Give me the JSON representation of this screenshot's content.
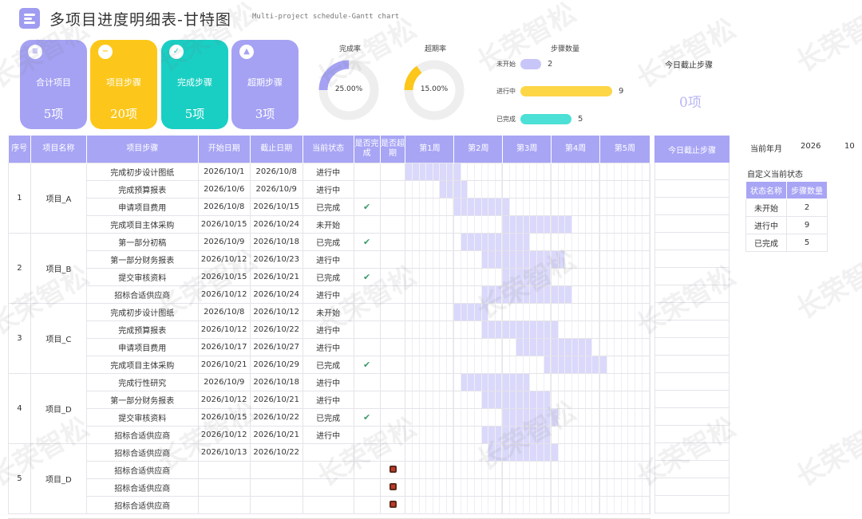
{
  "header": {
    "title": "多项目进度明细表-甘特图",
    "subtitle": "Multi-project schedule-Gantt chart"
  },
  "kpis": [
    {
      "label": "合计项目",
      "value": "5项",
      "color": "#a5a2f4",
      "icon": "list-icon"
    },
    {
      "label": "项目步骤",
      "value": "20项",
      "color": "#fcc71a",
      "icon": "minus-circle-icon"
    },
    {
      "label": "完成步骤",
      "value": "5项",
      "color": "#19cfc3",
      "icon": "check-circle-icon"
    },
    {
      "label": "超期步骤",
      "value": "3项",
      "color": "#a5a2f4",
      "icon": "warning-icon"
    }
  ],
  "donuts": [
    {
      "title": "完成率",
      "value_text": "25.00%",
      "fraction": 0.25,
      "color": "#a5a2f4"
    },
    {
      "title": "超期率",
      "value_text": "15.00%",
      "fraction": 0.15,
      "color": "#fcc71a"
    }
  ],
  "steps": {
    "title": "步骤数量",
    "max": 9,
    "rows": [
      {
        "label": "未开始",
        "count": "2",
        "value": 2,
        "color": "#c8c5f8"
      },
      {
        "label": "进行中",
        "count": "9",
        "value": 9,
        "color": "#fdd646"
      },
      {
        "label": "已完成",
        "count": "5",
        "value": 5,
        "color": "#4ce0d6"
      }
    ]
  },
  "today": {
    "title": "今日截止步骤",
    "value": "0项",
    "col_header": "今日截止步骤"
  },
  "gantt": {
    "headers": [
      "序号",
      "项目名称",
      "项目步骤",
      "开始日期",
      "截止日期",
      "当前状态",
      "是否完成",
      "是否超期"
    ],
    "weeks": [
      "第1周",
      "第2周",
      "第3周",
      "第4周",
      "第5周"
    ],
    "groups": [
      {
        "no": "1",
        "name": "项目_A",
        "rows": [
          {
            "step": "完成初步设计图纸",
            "start": "2026/10/1",
            "end": "2026/10/8",
            "status": "进行中",
            "done": false,
            "late": false,
            "d0": 1,
            "d1": 8
          },
          {
            "step": "完成预算报表",
            "start": "2026/10/6",
            "end": "2026/10/9",
            "status": "进行中",
            "done": false,
            "late": false,
            "d0": 6,
            "d1": 9
          },
          {
            "step": "申请项目费用",
            "start": "2026/10/8",
            "end": "2026/10/15",
            "status": "已完成",
            "done": true,
            "late": false,
            "d0": 8,
            "d1": 15
          },
          {
            "step": "完成项目主体采购",
            "start": "2026/10/15",
            "end": "2026/10/24",
            "status": "未开始",
            "done": false,
            "late": false,
            "d0": 15,
            "d1": 24
          }
        ]
      },
      {
        "no": "2",
        "name": "项目_B",
        "rows": [
          {
            "step": "第一部分初稿",
            "start": "2026/10/9",
            "end": "2026/10/18",
            "status": "已完成",
            "done": true,
            "late": false,
            "d0": 9,
            "d1": 18
          },
          {
            "step": "第一部分财务报表",
            "start": "2026/10/12",
            "end": "2026/10/23",
            "status": "进行中",
            "done": false,
            "late": false,
            "d0": 12,
            "d1": 23
          },
          {
            "step": "提交审核资料",
            "start": "2026/10/15",
            "end": "2026/10/21",
            "status": "已完成",
            "done": true,
            "late": false,
            "d0": 15,
            "d1": 21
          },
          {
            "step": "招标合适供应商",
            "start": "2026/10/12",
            "end": "2026/10/24",
            "status": "进行中",
            "done": false,
            "late": false,
            "d0": 12,
            "d1": 24
          }
        ]
      },
      {
        "no": "3",
        "name": "项目_C",
        "rows": [
          {
            "step": "完成初步设计图纸",
            "start": "2026/10/8",
            "end": "2026/10/12",
            "status": "未开始",
            "done": false,
            "late": false,
            "d0": 8,
            "d1": 12
          },
          {
            "step": "完成预算报表",
            "start": "2026/10/12",
            "end": "2026/10/22",
            "status": "进行中",
            "done": false,
            "late": false,
            "d0": 12,
            "d1": 22
          },
          {
            "step": "申请项目费用",
            "start": "2026/10/17",
            "end": "2026/10/27",
            "status": "进行中",
            "done": false,
            "late": false,
            "d0": 17,
            "d1": 27
          },
          {
            "step": "完成项目主体采购",
            "start": "2026/10/21",
            "end": "2026/10/29",
            "status": "已完成",
            "done": true,
            "late": false,
            "d0": 21,
            "d1": 29
          }
        ]
      },
      {
        "no": "4",
        "name": "项目_D",
        "rows": [
          {
            "step": "完成行性研究",
            "start": "2026/10/9",
            "end": "2026/10/18",
            "status": "进行中",
            "done": false,
            "late": false,
            "d0": 9,
            "d1": 18
          },
          {
            "step": "第一部分财务报表",
            "start": "2026/10/12",
            "end": "2026/10/21",
            "status": "进行中",
            "done": false,
            "late": false,
            "d0": 12,
            "d1": 21
          },
          {
            "step": "提交审核资料",
            "start": "2026/10/15",
            "end": "2026/10/22",
            "status": "已完成",
            "done": true,
            "late": false,
            "d0": 15,
            "d1": 22
          },
          {
            "step": "招标合适供应商",
            "start": "2026/10/12",
            "end": "2026/10/21",
            "status": "进行中",
            "done": false,
            "late": false,
            "d0": 12,
            "d1": 21
          }
        ]
      },
      {
        "no": "5",
        "name": "项目_D",
        "rows": [
          {
            "step": "招标合适供应商",
            "start": "2026/10/13",
            "end": "2026/10/22",
            "status": "",
            "done": false,
            "late": false,
            "d0": 13,
            "d1": 22
          },
          {
            "step": "招标合适供应商",
            "start": "",
            "end": "",
            "status": "",
            "done": false,
            "late": true,
            "d0": 0,
            "d1": 0
          },
          {
            "step": "招标合适供应商",
            "start": "",
            "end": "",
            "status": "",
            "done": false,
            "late": true,
            "d0": 0,
            "d1": 0
          },
          {
            "step": "招标合适供应商",
            "start": "",
            "end": "",
            "status": "",
            "done": false,
            "late": true,
            "d0": 0,
            "d1": 0
          }
        ]
      }
    ]
  },
  "right_panel": {
    "year_month_label": "当前年月",
    "year": "2026",
    "month": "10",
    "status_title": "自定义当前状态",
    "status_headers": [
      "状态名称",
      "步骤数量"
    ],
    "status_rows": [
      {
        "name": "未开始",
        "count": "2"
      },
      {
        "name": "进行中",
        "count": "9"
      },
      {
        "name": "已完成",
        "count": "5"
      }
    ]
  },
  "watermark": "长荣智松"
}
